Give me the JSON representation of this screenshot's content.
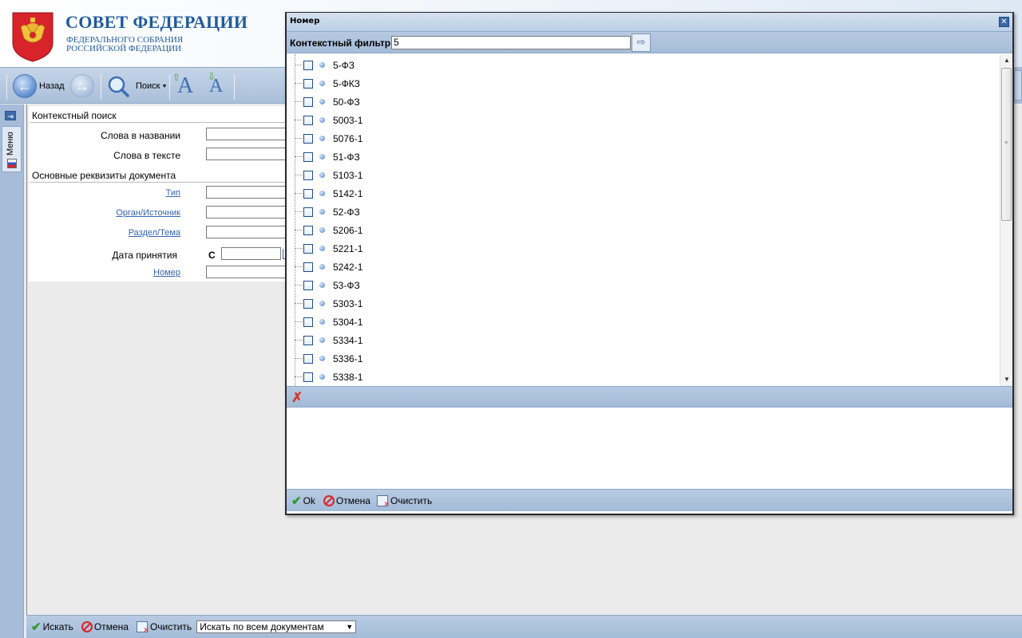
{
  "header": {
    "title": "СОВЕТ ФЕДЕРАЦИИ",
    "subtitle_line1": "ФЕДЕРАЛЬНОГО СОБРАНИЯ",
    "subtitle_line2": "РОССИЙСКОЙ ФЕДЕРАЦИИ",
    "emblem_icon": "coat-of-arms-icon"
  },
  "toolbar": {
    "back_label": "Назад",
    "search_label": "Поиск",
    "icons": [
      "back-arrow-icon",
      "forward-arrow-icon",
      "magnifier-icon",
      "font-increase-icon",
      "font-decrease-icon"
    ]
  },
  "side": {
    "menu_label": "Меню",
    "pin_icon": "pin-icon"
  },
  "form": {
    "context_search_header": "Контекстный поиск",
    "words_in_title_label": "Слова в названии",
    "words_in_text_label": "Слова в тексте",
    "main_attrs_header": "Основные реквизиты документа",
    "type_link": "Тип",
    "organ_link": "Орган/Источник",
    "section_link": "Раздел/Тема",
    "date_label": "Дата принятия",
    "date_from_label": "С",
    "number_link": "Номер"
  },
  "bottom_bar": {
    "search_label": "Искать",
    "cancel_label": "Отмена",
    "clear_label": "Очистить",
    "scope_select_value": "Искать по всем документам"
  },
  "modal": {
    "title": "Номер",
    "filter_label": "Контекстный фильтр",
    "filter_value": "5",
    "items": [
      "5-ФЗ",
      "5-ФКЗ",
      "50-ФЗ",
      "5003-1",
      "5076-1",
      "51-ФЗ",
      "5103-1",
      "5142-1",
      "52-ФЗ",
      "5206-1",
      "5221-1",
      "5242-1",
      "53-ФЗ",
      "5303-1",
      "5304-1",
      "5334-1",
      "5336-1",
      "5338-1"
    ],
    "ok_label": "Ok",
    "cancel_label": "Отмена",
    "clear_label": "Очистить"
  },
  "colors": {
    "brand_blue": "#1e5a9c",
    "panel_blue": "#a6bcd8",
    "link_blue": "#3464b0"
  }
}
